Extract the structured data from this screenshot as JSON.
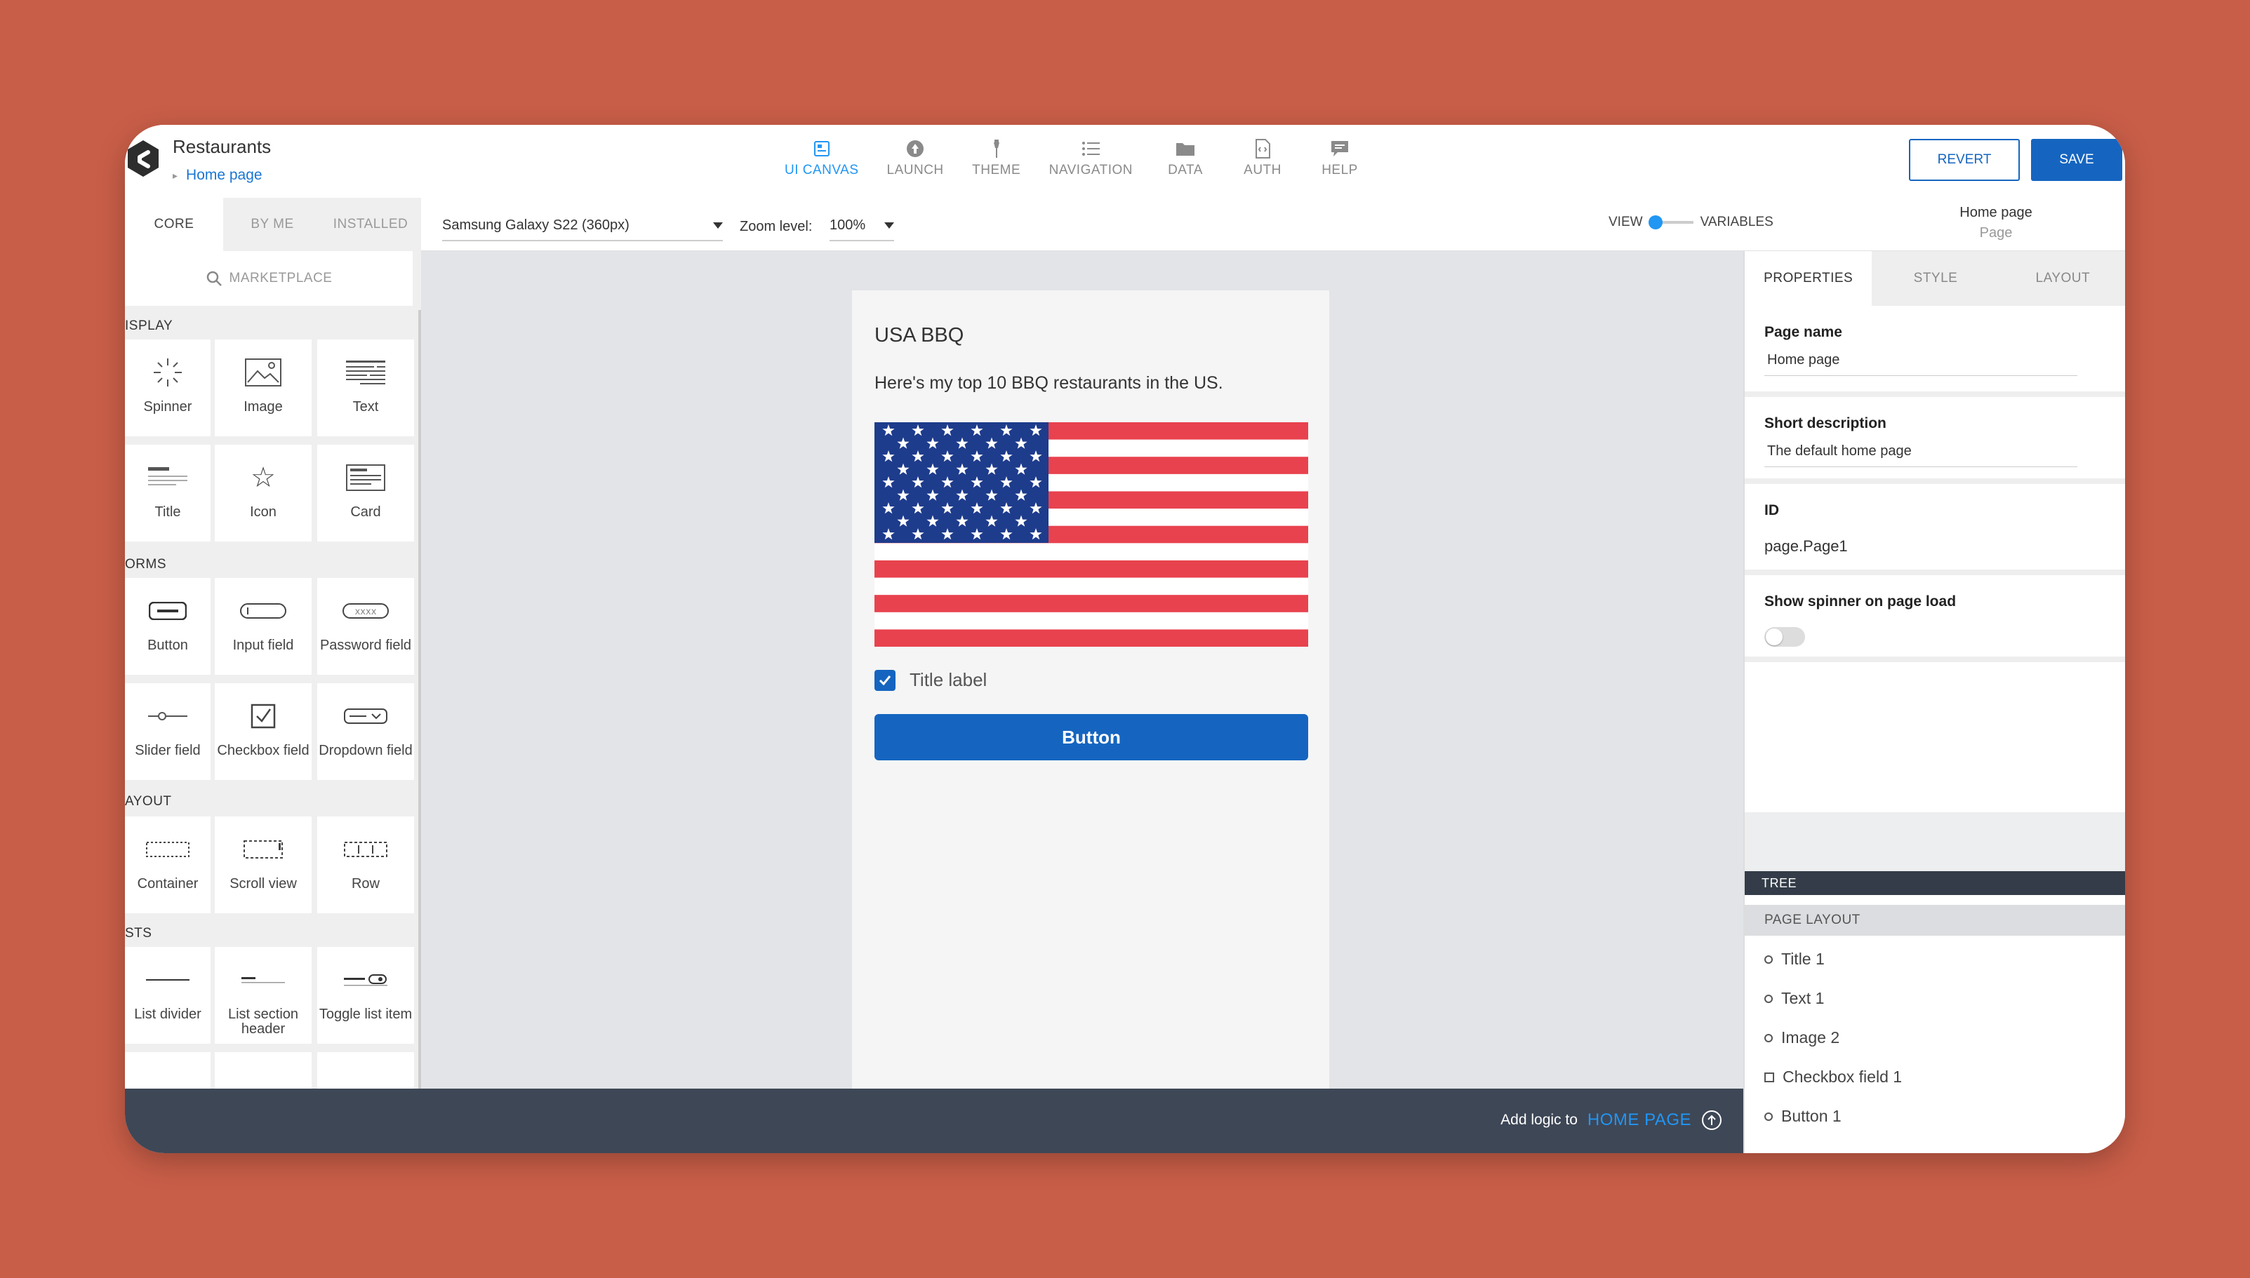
{
  "app": {
    "title": "Restaurants",
    "breadcrumb": "Home page"
  },
  "nav": [
    {
      "label": "UI CANVAS",
      "icon": "ui-canvas-icon",
      "active": true
    },
    {
      "label": "LAUNCH",
      "icon": "launch-icon"
    },
    {
      "label": "THEME",
      "icon": "theme-icon"
    },
    {
      "label": "NAVIGATION",
      "icon": "navigation-icon"
    },
    {
      "label": "DATA",
      "icon": "folder-icon"
    },
    {
      "label": "AUTH",
      "icon": "auth-icon"
    },
    {
      "label": "HELP",
      "icon": "help-chat-icon"
    }
  ],
  "actions": {
    "revert": "REVERT",
    "save": "SAVE"
  },
  "library": {
    "tabs": [
      "CORE",
      "BY ME",
      "INSTALLED"
    ],
    "marketplace": "MARKETPLACE",
    "sections": {
      "display": "ISPLAY",
      "forms": "ORMS",
      "layout": "AYOUT",
      "lists": "STS"
    },
    "items": {
      "spinner": "Spinner",
      "image": "Image",
      "text": "Text",
      "title": "Title",
      "icon": "Icon",
      "card": "Card",
      "button": "Button",
      "input_field": "Input field",
      "password_field": "Password field",
      "slider_field": "Slider field",
      "checkbox_field": "Checkbox field",
      "dropdown_field": "Dropdown field",
      "container": "Container",
      "scroll_view": "Scroll view",
      "row": "Row",
      "list_divider": "List divider",
      "list_section_header": "List section header",
      "toggle_list_item": "Toggle list item"
    }
  },
  "toolbar": {
    "device": "Samsung Galaxy S22 (360px)",
    "zoom_label": "Zoom level:",
    "zoom_value": "100%",
    "view": "VIEW",
    "variables": "VARIABLES",
    "page_name": "Home page",
    "page_type": "Page"
  },
  "canvas": {
    "title": "USA BBQ",
    "text": "Here's my top 10 BBQ restaurants in the US.",
    "image": "us-flag-image",
    "checkbox_label": "Title label",
    "checkbox_checked": true,
    "button": "Button"
  },
  "bottom": {
    "text": "Add logic to",
    "link": "HOME PAGE"
  },
  "properties": {
    "tabs": [
      "PROPERTIES",
      "STYLE",
      "LAYOUT"
    ],
    "page_name_label": "Page name",
    "page_name": "Home page",
    "short_desc_label": "Short description",
    "short_desc": "The default home page",
    "id_label": "ID",
    "id_value": "page.Page1",
    "spinner_label": "Show spinner on page load",
    "spinner_on": false
  },
  "tree": {
    "header": "TREE",
    "section": "PAGE LAYOUT",
    "items": [
      "Title 1",
      "Text 1",
      "Image 2",
      "Checkbox field 1",
      "Button 1"
    ]
  },
  "colors": {
    "accent": "#1565C0",
    "background": "#C95E48",
    "active_nav": "#2196F3"
  }
}
